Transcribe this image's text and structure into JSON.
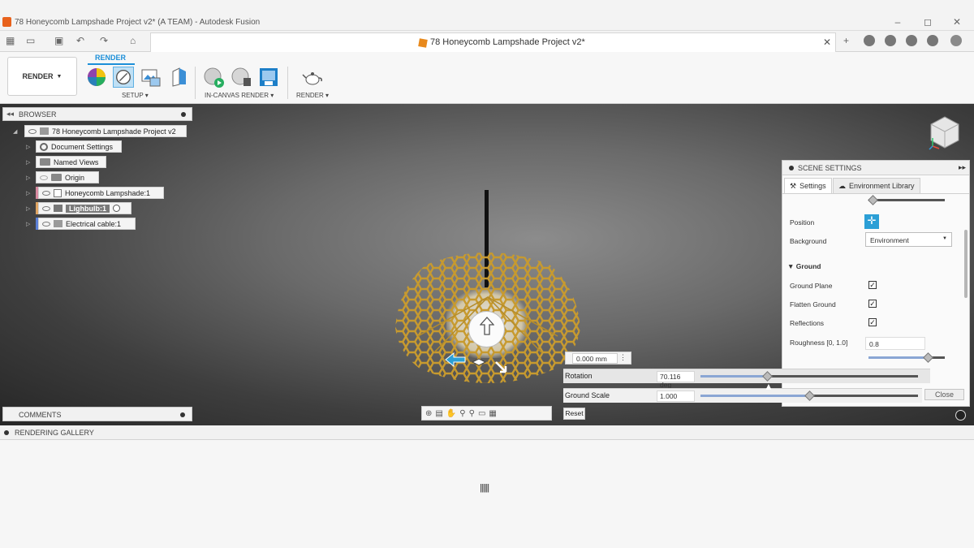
{
  "window": {
    "title": "78 Honeycomb Lampshade Project v2* (A TEAM) - Autodesk Fusion",
    "controls": [
      "–",
      "◻",
      "✕"
    ]
  },
  "document_tab": {
    "title": "78 Honeycomb Lampshade Project v2*"
  },
  "ribbon": {
    "workspace": "RENDER",
    "tab": "RENDER",
    "groups": [
      "SETUP ▾",
      "IN-CANVAS RENDER ▾",
      "RENDER ▾"
    ]
  },
  "browser": {
    "title": "BROWSER",
    "root": "78 Honeycomb Lampshade Project v2",
    "items": [
      {
        "label": "Document Settings"
      },
      {
        "label": "Named Views"
      },
      {
        "label": "Origin"
      },
      {
        "label": "Honeycomb Lampshade:1",
        "color": "#d98aa1"
      },
      {
        "label": "Lighbulb:1",
        "color": "#e0a562"
      },
      {
        "label": "Electrical cable:1",
        "color": "#5b7fd6"
      }
    ]
  },
  "comments": {
    "title": "COMMENTS"
  },
  "scene_settings": {
    "title": "SCENE SETTINGS",
    "tabs": [
      "Settings",
      "Environment Library"
    ],
    "position_label": "Position",
    "background_label": "Background",
    "background_value": "Environment",
    "ground_section": "Ground",
    "ground_plane_label": "Ground Plane",
    "flatten_ground_label": "Flatten Ground",
    "reflections_label": "Reflections",
    "roughness_label": "Roughness [0, 1.0]",
    "roughness_value": "0.8",
    "checkbox_mark": "✓"
  },
  "canvas": {
    "offset_value": "0.000 mm",
    "rotation_label": "Rotation",
    "rotation_value": "70.116 deg",
    "ground_scale_label": "Ground Scale",
    "ground_scale_value": "1.000",
    "close_label": "Close",
    "reset_label": "Reset",
    "colors": {
      "lamp": "#c79a2f",
      "accent": "#2b9fd6"
    }
  },
  "gallery": {
    "title": "RENDERING GALLERY"
  }
}
